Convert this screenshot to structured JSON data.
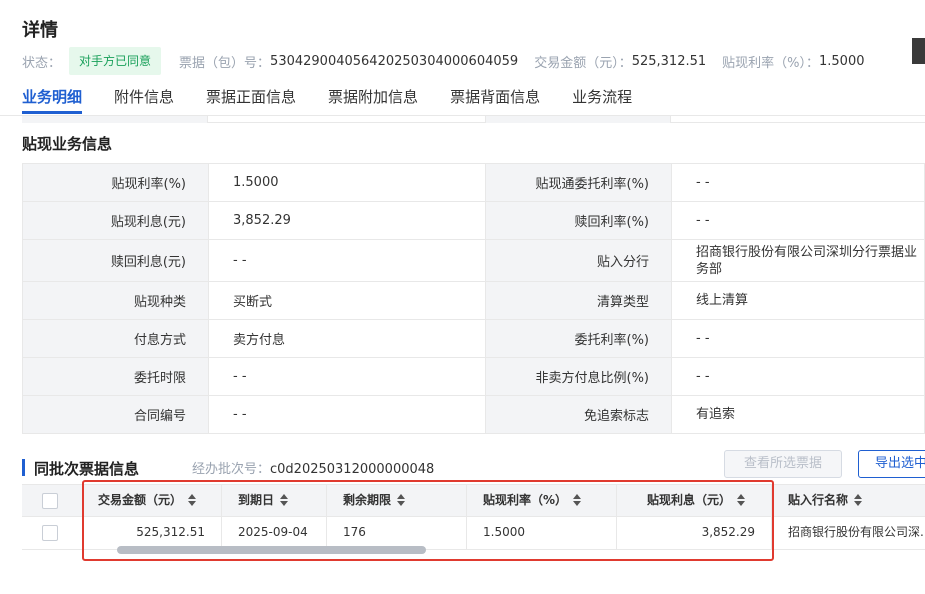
{
  "title": "详情",
  "meta": {
    "status_label": "状态：",
    "status_badge": "对手方已同意",
    "bill_no_label": "票据（包）号：",
    "bill_no": "530429004056420250304000604059",
    "amount_label": "交易金额（元）：",
    "amount": "525,312.51",
    "rate_label": "贴现利率（%）：",
    "rate": "1.5000"
  },
  "tabs": [
    "业务明细",
    "附件信息",
    "票据正面信息",
    "票据附加信息",
    "票据背面信息",
    "业务流程"
  ],
  "active_tab": "业务明细",
  "section_title": "贴现业务信息",
  "info_rows": [
    {
      "k1": "贴现利率(%)",
      "v1": "1.5000",
      "k2": "贴现通委托利率(%)",
      "v2": "- -"
    },
    {
      "k1": "贴现利息(元)",
      "v1": "3,852.29",
      "k2": "赎回利率(%)",
      "v2": "- -"
    },
    {
      "k1": "赎回利息(元)",
      "v1": "- -",
      "k2": "贴入分行",
      "v2": "招商银行股份有限公司深圳分行票据业务部"
    },
    {
      "k1": "贴现种类",
      "v1": "买断式",
      "k2": "清算类型",
      "v2": "线上清算"
    },
    {
      "k1": "付息方式",
      "v1": "卖方付息",
      "k2": "委托利率(%)",
      "v2": "- -"
    },
    {
      "k1": "委托时限",
      "v1": "- -",
      "k2": "非卖方付息比例(%)",
      "v2": "- -"
    },
    {
      "k1": "合同编号",
      "v1": "- -",
      "k2": "免追索标志",
      "v2": "有追索"
    }
  ],
  "batch": {
    "title": "同批次票据信息",
    "batch_no_label": "经办批次号：",
    "batch_no": "c0d20250312000000048",
    "view_selected_button": "查看所选票据",
    "export_button": "导出选中"
  },
  "grid": {
    "headers": [
      "交易金额（元）",
      "到期日",
      "剩余期限",
      "贴现利率（%）",
      "贴现利息（元）",
      "贴入行名称"
    ],
    "rows": [
      [
        "525,312.51",
        "2025-09-04",
        "176",
        "1.5000",
        "3,852.29",
        "招商银行股份有限公司深..."
      ]
    ]
  }
}
